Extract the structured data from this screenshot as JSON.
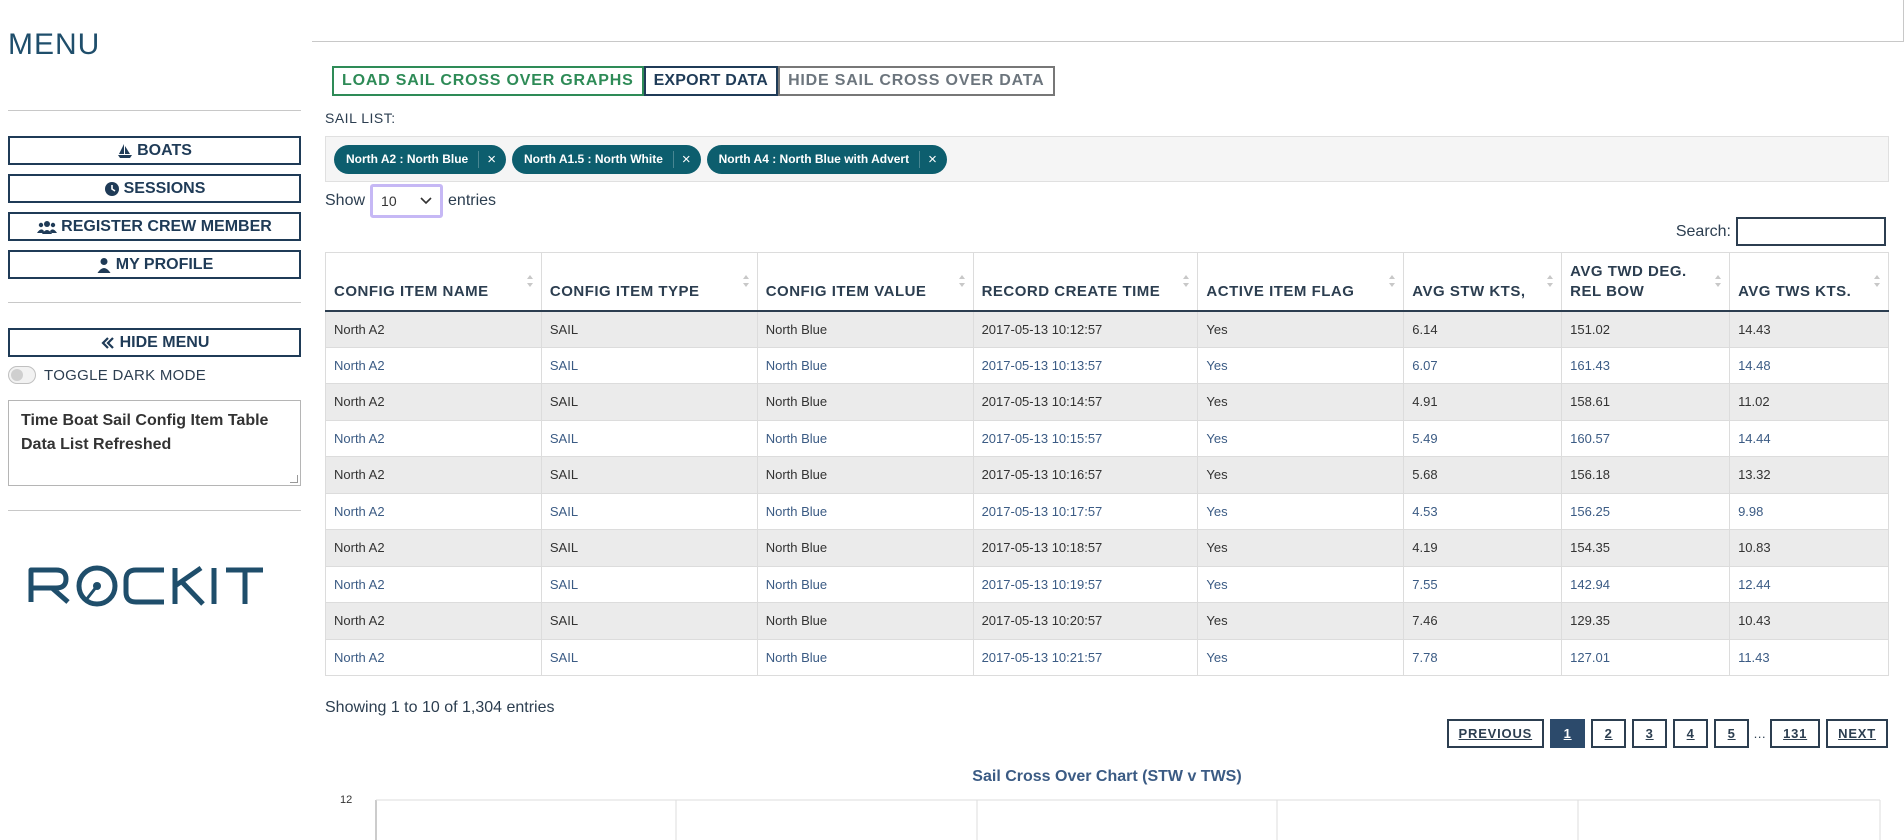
{
  "sidebar": {
    "title": "MENU",
    "buttons": {
      "boats": "BOATS",
      "sessions": "SESSIONS",
      "register_crew": "REGISTER CREW MEMBER",
      "my_profile": "MY PROFILE",
      "hide_menu": "HIDE MENU"
    },
    "toggle_label": "TOGGLE DARK MODE",
    "status_message": "Time Boat Sail Config Item Table Data List Refreshed",
    "logo_text": "ROCKIT"
  },
  "toolbar": {
    "load_label": "LOAD SAIL CROSS OVER GRAPHS",
    "export_label": "EXPORT DATA",
    "hide_label": "HIDE SAIL CROSS OVER DATA"
  },
  "sail_list": {
    "label": "SAIL LIST:",
    "chips": [
      "North A2 : North Blue",
      "North A1.5 : North White",
      "North A4 : North Blue with Advert"
    ],
    "remove_glyph": "×"
  },
  "length": {
    "show": "Show",
    "value": "10",
    "entries": "entries"
  },
  "search": {
    "label": "Search:",
    "value": ""
  },
  "table": {
    "headers": [
      "CONFIG ITEM NAME",
      "CONFIG ITEM TYPE",
      "CONFIG ITEM VALUE",
      "RECORD CREATE TIME",
      "ACTIVE ITEM FLAG",
      "AVG STW KTS,",
      "AVG TWD DEG. REL BOW",
      "AVG TWS KTS."
    ],
    "rows": [
      [
        "North A2",
        "SAIL",
        "North Blue",
        "2017-05-13 10:12:57",
        "Yes",
        "6.14",
        "151.02",
        "14.43"
      ],
      [
        "North A2",
        "SAIL",
        "North Blue",
        "2017-05-13 10:13:57",
        "Yes",
        "6.07",
        "161.43",
        "14.48"
      ],
      [
        "North A2",
        "SAIL",
        "North Blue",
        "2017-05-13 10:14:57",
        "Yes",
        "4.91",
        "158.61",
        "11.02"
      ],
      [
        "North A2",
        "SAIL",
        "North Blue",
        "2017-05-13 10:15:57",
        "Yes",
        "5.49",
        "160.57",
        "14.44"
      ],
      [
        "North A2",
        "SAIL",
        "North Blue",
        "2017-05-13 10:16:57",
        "Yes",
        "5.68",
        "156.18",
        "13.32"
      ],
      [
        "North A2",
        "SAIL",
        "North Blue",
        "2017-05-13 10:17:57",
        "Yes",
        "4.53",
        "156.25",
        "9.98"
      ],
      [
        "North A2",
        "SAIL",
        "North Blue",
        "2017-05-13 10:18:57",
        "Yes",
        "4.19",
        "154.35",
        "10.83"
      ],
      [
        "North A2",
        "SAIL",
        "North Blue",
        "2017-05-13 10:19:57",
        "Yes",
        "7.55",
        "142.94",
        "12.44"
      ],
      [
        "North A2",
        "SAIL",
        "North Blue",
        "2017-05-13 10:20:57",
        "Yes",
        "7.46",
        "129.35",
        "10.43"
      ],
      [
        "North A2",
        "SAIL",
        "North Blue",
        "2017-05-13 10:21:57",
        "Yes",
        "7.78",
        "127.01",
        "11.43"
      ]
    ]
  },
  "info_text": "Showing 1 to 10 of 1,304 entries",
  "pagination": {
    "previous": "PREVIOUS",
    "pages": [
      "1",
      "2",
      "3",
      "4",
      "5"
    ],
    "ellipsis": "…",
    "last": "131",
    "next": "NEXT",
    "current": "1"
  },
  "chart": {
    "title": "Sail Cross Over Chart (STW v TWS)",
    "y_tick_top": "12"
  },
  "colors": {
    "navy": "#1f3b57",
    "green": "#2e8b57",
    "chip": "#0d5e6e",
    "active_page": "#2c4a6b"
  }
}
